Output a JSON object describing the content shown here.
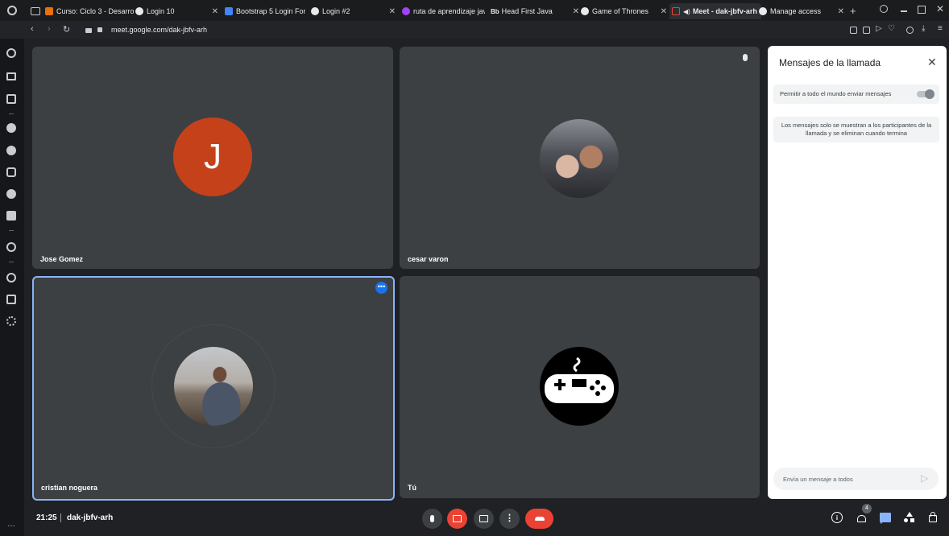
{
  "tabs": [
    {
      "label": "Curso: Ciclo 3 - Desarro"
    },
    {
      "label": "Login 10"
    },
    {
      "label": "Bootstrap 5 Login Form"
    },
    {
      "label": "Login #2"
    },
    {
      "label": "ruta de aprendizaje java"
    },
    {
      "label": "Head First Java"
    },
    {
      "label": "Game of Thrones"
    },
    {
      "label": "Meet - dak-jbfv-arh"
    },
    {
      "label": "Manage access"
    }
  ],
  "address": {
    "url": "meet.google.com/dak-jbfv-arh"
  },
  "participants": [
    {
      "name": "Jose Gomez",
      "initial": "J",
      "avatar_color": "#c5411a"
    },
    {
      "name": "cesar varon"
    },
    {
      "name": "cristian noguera"
    },
    {
      "name": "Tú"
    }
  ],
  "chat": {
    "title": "Mensajes de la llamada",
    "allow_label": "Permitir a todo el mundo enviar mensajes",
    "info": "Los mensajes solo se muestran a los participantes de la llamada y se eliminan cuando termina",
    "input_placeholder": "Envía un mensaje a todos"
  },
  "meeting": {
    "time": "21:25",
    "code": "dak-jbfv-arh",
    "people_count": "4"
  },
  "colors": {
    "hangup": "#ea4335",
    "accent": "#8ab4f8",
    "chat_active": "#8ab4f8"
  }
}
